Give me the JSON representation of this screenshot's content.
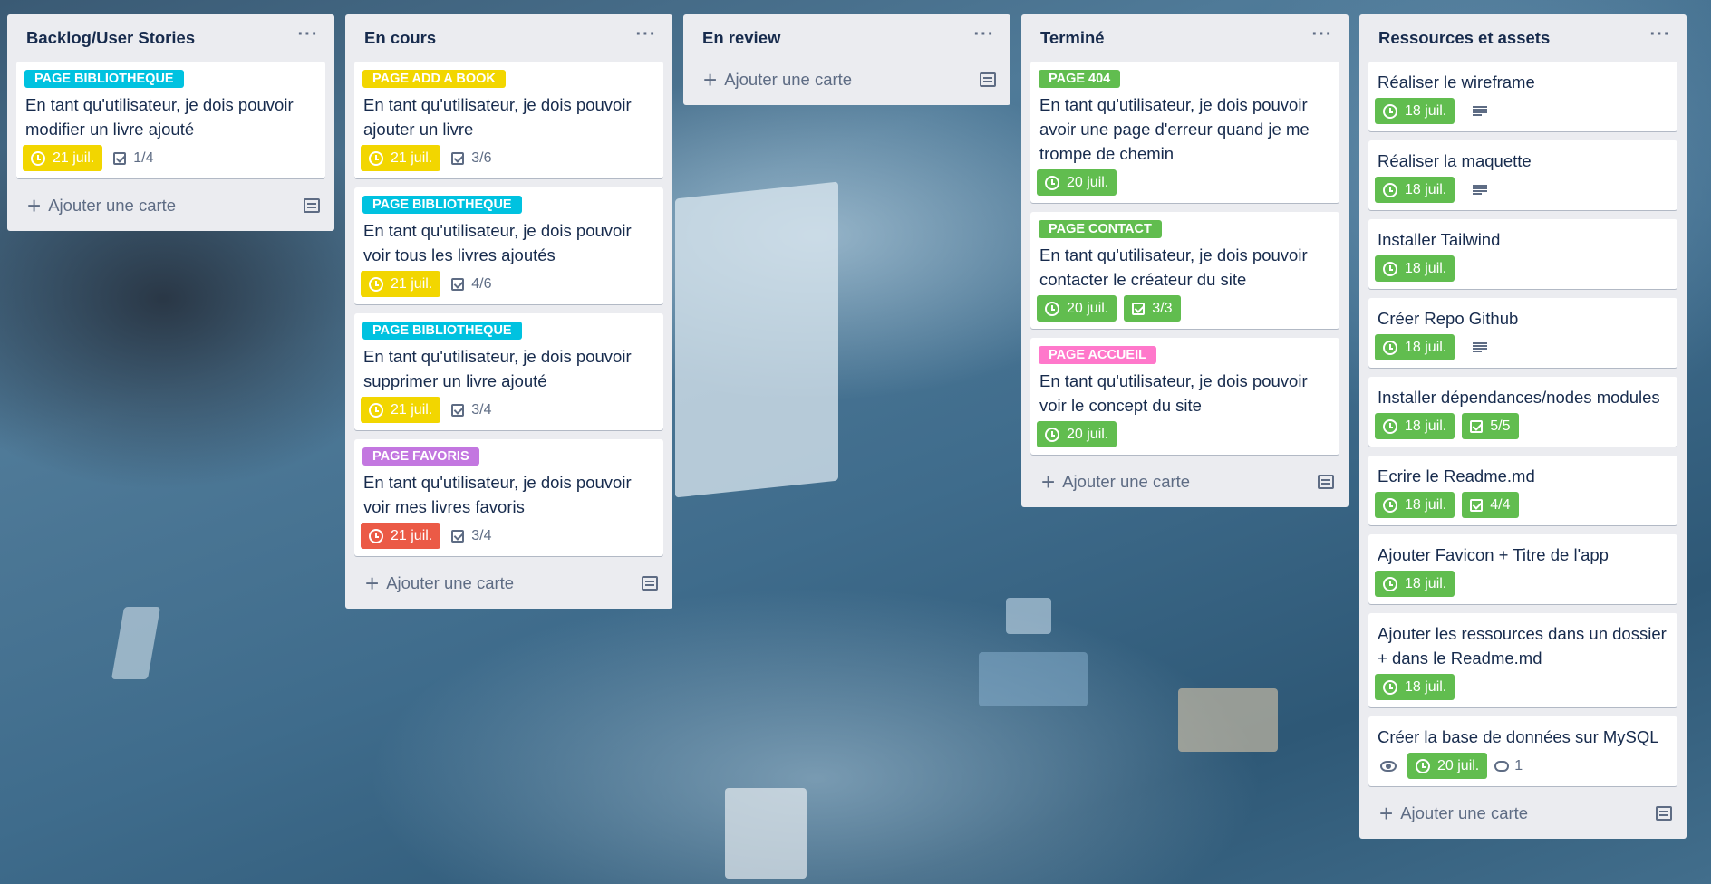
{
  "lists": [
    {
      "title": "Backlog/User Stories",
      "menu": "···",
      "add_label": "Ajouter une carte",
      "cards": [
        {
          "label": "PAGE BIBLIOTHEQUE",
          "label_color": "#00c2e0",
          "text": "En tant qu'utilisateur, je dois pouvoir modifier un livre ajouté",
          "due": "21 juil.",
          "due_color": "yellow",
          "checklist": "1/4"
        }
      ]
    },
    {
      "title": "En cours",
      "menu": "···",
      "add_label": "Ajouter une carte",
      "cards": [
        {
          "label": "PAGE ADD A BOOK",
          "label_color": "#f2d600",
          "text": "En tant qu'utilisateur, je dois pouvoir ajouter un livre",
          "due": "21 juil.",
          "due_color": "yellow",
          "checklist": "3/6"
        },
        {
          "label": "PAGE BIBLIOTHEQUE",
          "label_color": "#00c2e0",
          "text": "En tant qu'utilisateur, je dois pouvoir voir tous les livres ajoutés",
          "due": "21 juil.",
          "due_color": "yellow",
          "checklist": "4/6"
        },
        {
          "label": "PAGE BIBLIOTHEQUE",
          "label_color": "#00c2e0",
          "text": "En tant qu'utilisateur, je dois pouvoir supprimer un livre ajouté",
          "due": "21 juil.",
          "due_color": "yellow",
          "checklist": "3/4"
        },
        {
          "label": "PAGE FAVORIS",
          "label_color": "#c377e0",
          "text": "En tant qu'utilisateur, je dois pouvoir voir mes livres favoris",
          "due": "21 juil.",
          "due_color": "red",
          "checklist": "3/4"
        }
      ]
    },
    {
      "title": "En review",
      "menu": "···",
      "add_label": "Ajouter une carte",
      "cards": []
    },
    {
      "title": "Terminé",
      "menu": "···",
      "add_label": "Ajouter une carte",
      "cards": [
        {
          "label": "PAGE 404",
          "label_color": "#61bd4f",
          "text": "En tant qu'utilisateur, je dois pouvoir avoir une page d'erreur quand je me trompe de chemin",
          "due": "20 juil.",
          "due_color": "green"
        },
        {
          "label": "PAGE CONTACT",
          "label_color": "#61bd4f",
          "text": "En tant qu'utilisateur, je dois pouvoir contacter le créateur du site",
          "due": "20 juil.",
          "due_color": "green",
          "checklist": "3/3",
          "checklist_done": true
        },
        {
          "label": "PAGE ACCUEIL",
          "label_color": "#ff78cb",
          "text": "En tant qu'utilisateur, je dois pouvoir voir le concept du site",
          "due": "20 juil.",
          "due_color": "green"
        }
      ]
    },
    {
      "title": "Ressources et assets",
      "menu": "···",
      "add_label": "Ajouter une carte",
      "cards": [
        {
          "text": "Réaliser le wireframe",
          "due": "18 juil.",
          "due_color": "green",
          "description": true
        },
        {
          "text": "Réaliser la maquette",
          "due": "18 juil.",
          "due_color": "green",
          "description": true
        },
        {
          "text": "Installer Tailwind",
          "due": "18 juil.",
          "due_color": "green"
        },
        {
          "text": "Créer Repo Github",
          "due": "18 juil.",
          "due_color": "green",
          "description": true
        },
        {
          "text": "Installer dépendances/nodes modules",
          "due": "18 juil.",
          "due_color": "green",
          "checklist": "5/5",
          "checklist_done": true
        },
        {
          "text": "Ecrire le Readme.md",
          "due": "18 juil.",
          "due_color": "green",
          "checklist": "4/4",
          "checklist_done": true
        },
        {
          "text": "Ajouter Favicon + Titre de l'app",
          "due": "18 juil.",
          "due_color": "green"
        },
        {
          "text": "Ajouter les ressources dans un dossier + dans le Readme.md",
          "due": "18 juil.",
          "due_color": "green"
        },
        {
          "text": "Créer la base de données sur MySQL",
          "watching": true,
          "due": "20 juil.",
          "due_color": "green",
          "comments": "1"
        }
      ]
    }
  ]
}
